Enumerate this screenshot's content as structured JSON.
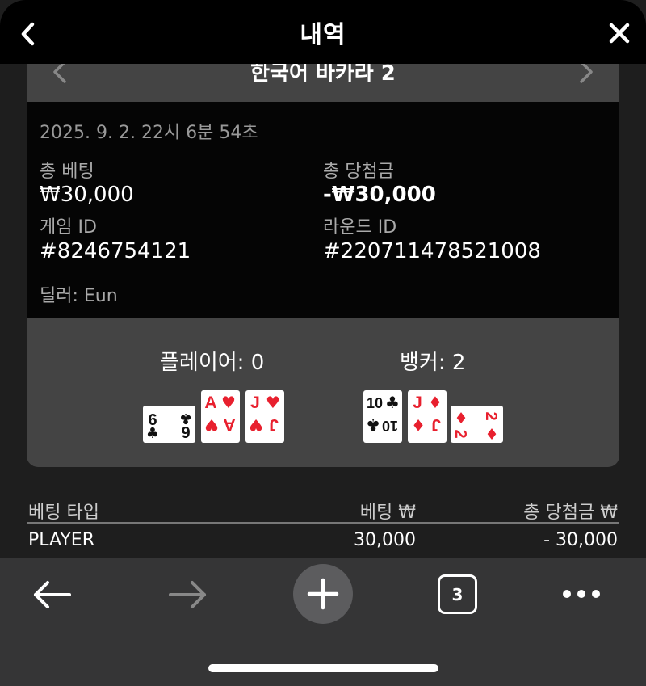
{
  "header": {
    "title": "내역"
  },
  "game": {
    "name": "한국어 바카라 2"
  },
  "info": {
    "datetime": "2025. 9. 2. 22시 6분 54초",
    "total_bet_label": "총 베팅",
    "total_bet_value": "₩30,000",
    "total_win_label": "총 당첨금",
    "total_win_value": "-₩30,000",
    "game_id_label": "게임 ID",
    "game_id_value": "#8246754121",
    "round_id_label": "라운드 ID",
    "round_id_value": "#220711478521008",
    "dealer": "딜러: Eun"
  },
  "hands": {
    "player_label": "플레이어: 0",
    "banker_label": "뱅커: 2",
    "player_cards": [
      {
        "rank": "6",
        "suit": "clubs",
        "orientation": "sideways"
      },
      {
        "rank": "A",
        "suit": "hearts",
        "orientation": "upright"
      },
      {
        "rank": "J",
        "suit": "hearts",
        "orientation": "upright"
      }
    ],
    "banker_cards": [
      {
        "rank": "10",
        "suit": "clubs",
        "orientation": "upright"
      },
      {
        "rank": "J",
        "suit": "diamonds",
        "orientation": "upright"
      },
      {
        "rank": "2",
        "suit": "diamonds",
        "orientation": "sideways"
      }
    ]
  },
  "bets": {
    "headers": [
      "베팅 타입",
      "베팅 ₩",
      "총 당첨금 ₩"
    ],
    "rows": [
      {
        "type": "PLAYER",
        "bet": "30,000",
        "win": "- 30,000"
      }
    ]
  },
  "toolbar": {
    "tab_count": "3"
  },
  "colors": {
    "red_suit": "#e8202e",
    "black_suit": "#111111",
    "panel": "#444444",
    "info_bg": "#050505"
  },
  "icons": [
    "back-chevron-icon",
    "close-icon",
    "chevron-left-icon",
    "chevron-right-icon",
    "arrow-left-icon",
    "arrow-right-icon",
    "plus-icon",
    "tabs-icon",
    "more-icon"
  ]
}
